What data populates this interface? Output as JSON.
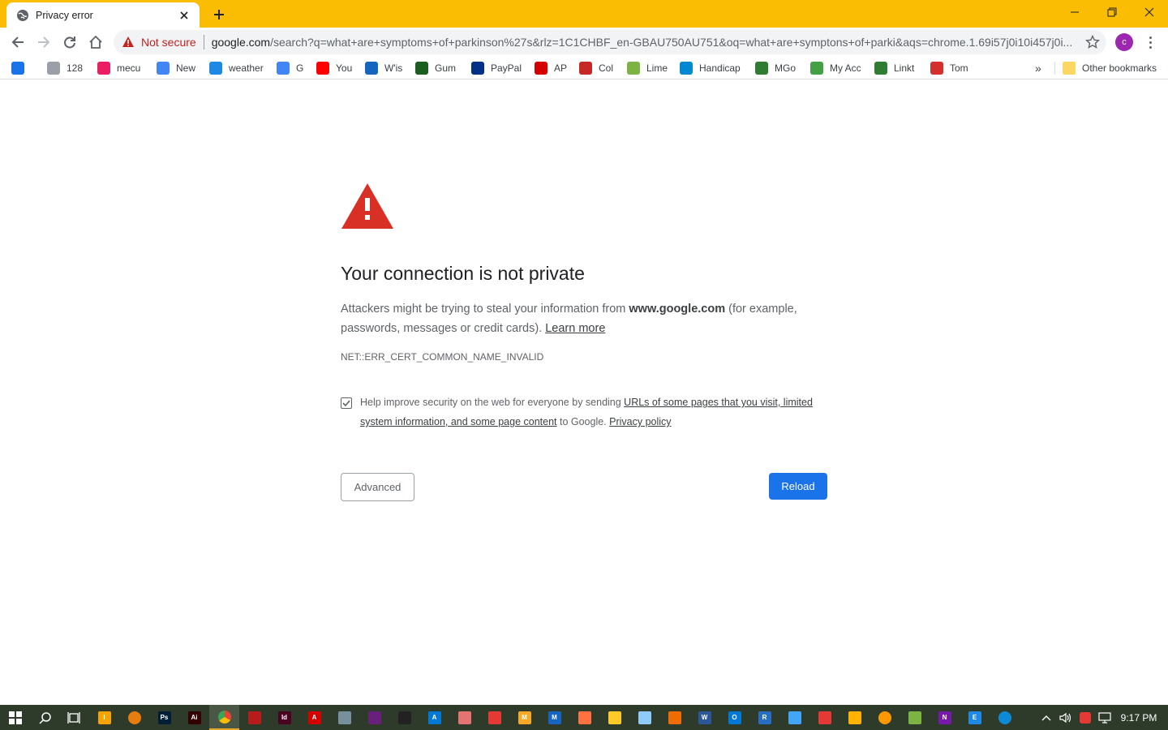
{
  "browser": {
    "tab": {
      "title": "Privacy error",
      "favicon": "globe-icon"
    },
    "omnibox": {
      "security_label": "Not secure",
      "url_host": "google.com",
      "url_path": "/search?q=what+are+symptoms+of+parkinson%27s&rlz=1C1CHBF_en-GBAU750AU751&oq=what+are+symptons+of+parki&aqs=chrome.1.69i57j0i10i457j0i..."
    },
    "profile_initial": "c",
    "accent_color": "#fbbc04"
  },
  "bookmarks": {
    "items": [
      {
        "label": "",
        "icon": "shopping-bag-icon",
        "color": "#1a73e8"
      },
      {
        "label": "128",
        "icon": "disc-icon",
        "color": "#9aa0a6"
      },
      {
        "label": "mecu",
        "icon": "mecu-icon",
        "color": "#e91e63"
      },
      {
        "label": "New",
        "icon": "gs-icon",
        "color": "#4285f4"
      },
      {
        "label": "weather",
        "icon": "wz-icon",
        "color": "#1e88e5"
      },
      {
        "label": "G",
        "icon": "google-icon",
        "color": "#4285f4"
      },
      {
        "label": "You",
        "icon": "youtube-icon",
        "color": "#ff0000"
      },
      {
        "label": "W'is",
        "icon": "plane-icon",
        "color": "#1565c0"
      },
      {
        "label": "Gum",
        "icon": "gumtree-icon",
        "color": "#1b5e20"
      },
      {
        "label": "PayPal",
        "icon": "paypal-icon",
        "color": "#003087"
      },
      {
        "label": "AP",
        "icon": "ap-icon",
        "color": "#d50000"
      },
      {
        "label": "Col",
        "icon": "coles-icon",
        "color": "#c62828"
      },
      {
        "label": "Lime",
        "icon": "lime-icon",
        "color": "#7cb342"
      },
      {
        "label": "Handicap",
        "icon": "globe-icon",
        "color": "#0288d1"
      },
      {
        "label": "MGo",
        "icon": "mygov-icon",
        "color": "#2e7d32"
      },
      {
        "label": "My Acc",
        "icon": "refresh-green-icon",
        "color": "#43a047"
      },
      {
        "label": "Linkt",
        "icon": "car-icon",
        "color": "#2e7d32"
      },
      {
        "label": "Tom",
        "icon": "tom-icon",
        "color": "#d32f2f"
      }
    ],
    "other_label": "Other bookmarks"
  },
  "interstitial": {
    "heading": "Your connection is not private",
    "explain_pre": "Attackers might be trying to steal your information from ",
    "explain_host": "www.google.com",
    "explain_post": " (for example, passwords, messages or credit cards). ",
    "learn_more": "Learn more",
    "error_code": "NET::ERR_CERT_COMMON_NAME_INVALID",
    "optin_pre": "Help improve security on the web for everyone by sending ",
    "optin_link": "URLs of some pages that you visit, limited system information, and some page content",
    "optin_mid": " to Google. ",
    "optin_privacy": "Privacy policy",
    "optin_checked": true,
    "advanced_label": "Advanced",
    "reload_label": "Reload",
    "warning_color": "#d93025",
    "button_color": "#1a73e8"
  },
  "taskbar": {
    "apps": [
      {
        "name": "illustrator-draw-icon",
        "label": "I",
        "color": "#f4a300"
      },
      {
        "name": "blender-icon",
        "label": "",
        "color": "#e87d0d"
      },
      {
        "name": "photoshop-icon",
        "label": "Ps",
        "color": "#001e36"
      },
      {
        "name": "illustrator-icon",
        "label": "Ai",
        "color": "#330000"
      },
      {
        "name": "chrome-icon",
        "label": "",
        "color": "#fbbc04"
      },
      {
        "name": "red-eye-icon",
        "label": "",
        "color": "#b71c1c"
      },
      {
        "name": "indesign-icon",
        "label": "Id",
        "color": "#49021f"
      },
      {
        "name": "acrobat-icon",
        "label": "A",
        "color": "#d50000"
      },
      {
        "name": "gear-app-icon",
        "label": "",
        "color": "#78909c"
      },
      {
        "name": "visual-studio-icon",
        "label": "",
        "color": "#68217a"
      },
      {
        "name": "unity-icon",
        "label": "",
        "color": "#222222"
      },
      {
        "name": "azure-icon",
        "label": "A",
        "color": "#0078d4"
      },
      {
        "name": "paint-icon",
        "label": "",
        "color": "#e57373"
      },
      {
        "name": "pdf-icon",
        "label": "",
        "color": "#e53935"
      },
      {
        "name": "m-app-icon",
        "label": "M",
        "color": "#f9a825"
      },
      {
        "name": "m-blue-icon",
        "label": "M",
        "color": "#1565c0"
      },
      {
        "name": "tools-icon",
        "label": "",
        "color": "#ff7043"
      },
      {
        "name": "file-explorer-icon",
        "label": "",
        "color": "#ffca28"
      },
      {
        "name": "notepad-icon",
        "label": "",
        "color": "#90caf9"
      },
      {
        "name": "matlab-icon",
        "label": "",
        "color": "#ef6c00"
      },
      {
        "name": "word-icon",
        "label": "W",
        "color": "#2b579a"
      },
      {
        "name": "outlook-icon",
        "label": "O",
        "color": "#0078d4"
      },
      {
        "name": "r-icon",
        "label": "R",
        "color": "#276dc3"
      },
      {
        "name": "remote-icon",
        "label": "",
        "color": "#42a5f5"
      },
      {
        "name": "security-icon",
        "label": "",
        "color": "#e53935"
      },
      {
        "name": "media-icon",
        "label": "",
        "color": "#ffb300"
      },
      {
        "name": "ubuntu-icon",
        "label": "",
        "color": "#ff9800"
      },
      {
        "name": "shield-app-icon",
        "label": "",
        "color": "#7cb342"
      },
      {
        "name": "onenote-icon",
        "label": "N",
        "color": "#7719aa"
      },
      {
        "name": "e-reader-icon",
        "label": "E",
        "color": "#1e88e5"
      },
      {
        "name": "edge-icon",
        "label": "",
        "color": "#0c8ad7"
      }
    ],
    "time": "9:17 PM"
  }
}
